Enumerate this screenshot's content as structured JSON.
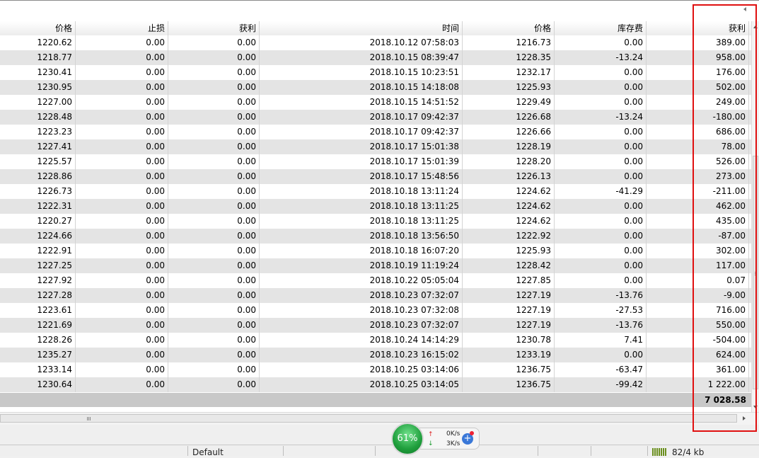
{
  "columns": [
    {
      "key": "price_open",
      "label": "价格"
    },
    {
      "key": "sl",
      "label": "止损"
    },
    {
      "key": "tp",
      "label": "获利"
    },
    {
      "key": "time",
      "label": "时间"
    },
    {
      "key": "price_close",
      "label": "价格"
    },
    {
      "key": "swap",
      "label": "库存费"
    },
    {
      "key": "profit",
      "label": "获利"
    }
  ],
  "rows": [
    [
      "1220.62",
      "0.00",
      "0.00",
      "2018.10.12 07:58:03",
      "1216.73",
      "0.00",
      "389.00"
    ],
    [
      "1218.77",
      "0.00",
      "0.00",
      "2018.10.15 08:39:47",
      "1228.35",
      "-13.24",
      "958.00"
    ],
    [
      "1230.41",
      "0.00",
      "0.00",
      "2018.10.15 10:23:51",
      "1232.17",
      "0.00",
      "176.00"
    ],
    [
      "1230.95",
      "0.00",
      "0.00",
      "2018.10.15 14:18:08",
      "1225.93",
      "0.00",
      "502.00"
    ],
    [
      "1227.00",
      "0.00",
      "0.00",
      "2018.10.15 14:51:52",
      "1229.49",
      "0.00",
      "249.00"
    ],
    [
      "1228.48",
      "0.00",
      "0.00",
      "2018.10.17 09:42:37",
      "1226.68",
      "-13.24",
      "-180.00"
    ],
    [
      "1223.23",
      "0.00",
      "0.00",
      "2018.10.17 09:42:37",
      "1226.66",
      "0.00",
      "686.00"
    ],
    [
      "1227.41",
      "0.00",
      "0.00",
      "2018.10.17 15:01:38",
      "1228.19",
      "0.00",
      "78.00"
    ],
    [
      "1225.57",
      "0.00",
      "0.00",
      "2018.10.17 15:01:39",
      "1228.20",
      "0.00",
      "526.00"
    ],
    [
      "1228.86",
      "0.00",
      "0.00",
      "2018.10.17 15:48:56",
      "1226.13",
      "0.00",
      "273.00"
    ],
    [
      "1226.73",
      "0.00",
      "0.00",
      "2018.10.18 13:11:24",
      "1224.62",
      "-41.29",
      "-211.00"
    ],
    [
      "1222.31",
      "0.00",
      "0.00",
      "2018.10.18 13:11:25",
      "1224.62",
      "0.00",
      "462.00"
    ],
    [
      "1220.27",
      "0.00",
      "0.00",
      "2018.10.18 13:11:25",
      "1224.62",
      "0.00",
      "435.00"
    ],
    [
      "1224.66",
      "0.00",
      "0.00",
      "2018.10.18 13:56:50",
      "1222.92",
      "0.00",
      "-87.00"
    ],
    [
      "1222.91",
      "0.00",
      "0.00",
      "2018.10.18 16:07:20",
      "1225.93",
      "0.00",
      "302.00"
    ],
    [
      "1227.25",
      "0.00",
      "0.00",
      "2018.10.19 11:19:24",
      "1228.42",
      "0.00",
      "117.00"
    ],
    [
      "1227.92",
      "0.00",
      "0.00",
      "2018.10.22 05:05:04",
      "1227.85",
      "0.00",
      "0.07"
    ],
    [
      "1227.28",
      "0.00",
      "0.00",
      "2018.10.23 07:32:07",
      "1227.19",
      "-13.76",
      "-9.00"
    ],
    [
      "1223.61",
      "0.00",
      "0.00",
      "2018.10.23 07:32:08",
      "1227.19",
      "-27.53",
      "716.00"
    ],
    [
      "1221.69",
      "0.00",
      "0.00",
      "2018.10.23 07:32:07",
      "1227.19",
      "-13.76",
      "550.00"
    ],
    [
      "1228.26",
      "0.00",
      "0.00",
      "2018.10.24 14:14:29",
      "1230.78",
      "7.41",
      "-504.00"
    ],
    [
      "1235.27",
      "0.00",
      "0.00",
      "2018.10.23 16:15:02",
      "1233.19",
      "0.00",
      "624.00"
    ],
    [
      "1233.14",
      "0.00",
      "0.00",
      "2018.10.25 03:14:06",
      "1236.75",
      "-63.47",
      "361.00"
    ],
    [
      "1230.64",
      "0.00",
      "0.00",
      "2018.10.25 03:14:05",
      "1236.75",
      "-99.42",
      "1 222.00"
    ]
  ],
  "total_profit": "7 028.58",
  "status": {
    "profile": "Default",
    "traffic": "82/4 kb"
  },
  "net_widget": {
    "percent": "61%",
    "upload": "0K/s",
    "download": "3K/s",
    "plus_glyph": "+",
    "up_glyph": "↑",
    "down_glyph": "↓"
  },
  "colors": {
    "highlight": "#e01010",
    "row_alt": "#e4e4e4",
    "total_bg": "#c8c8c8"
  }
}
